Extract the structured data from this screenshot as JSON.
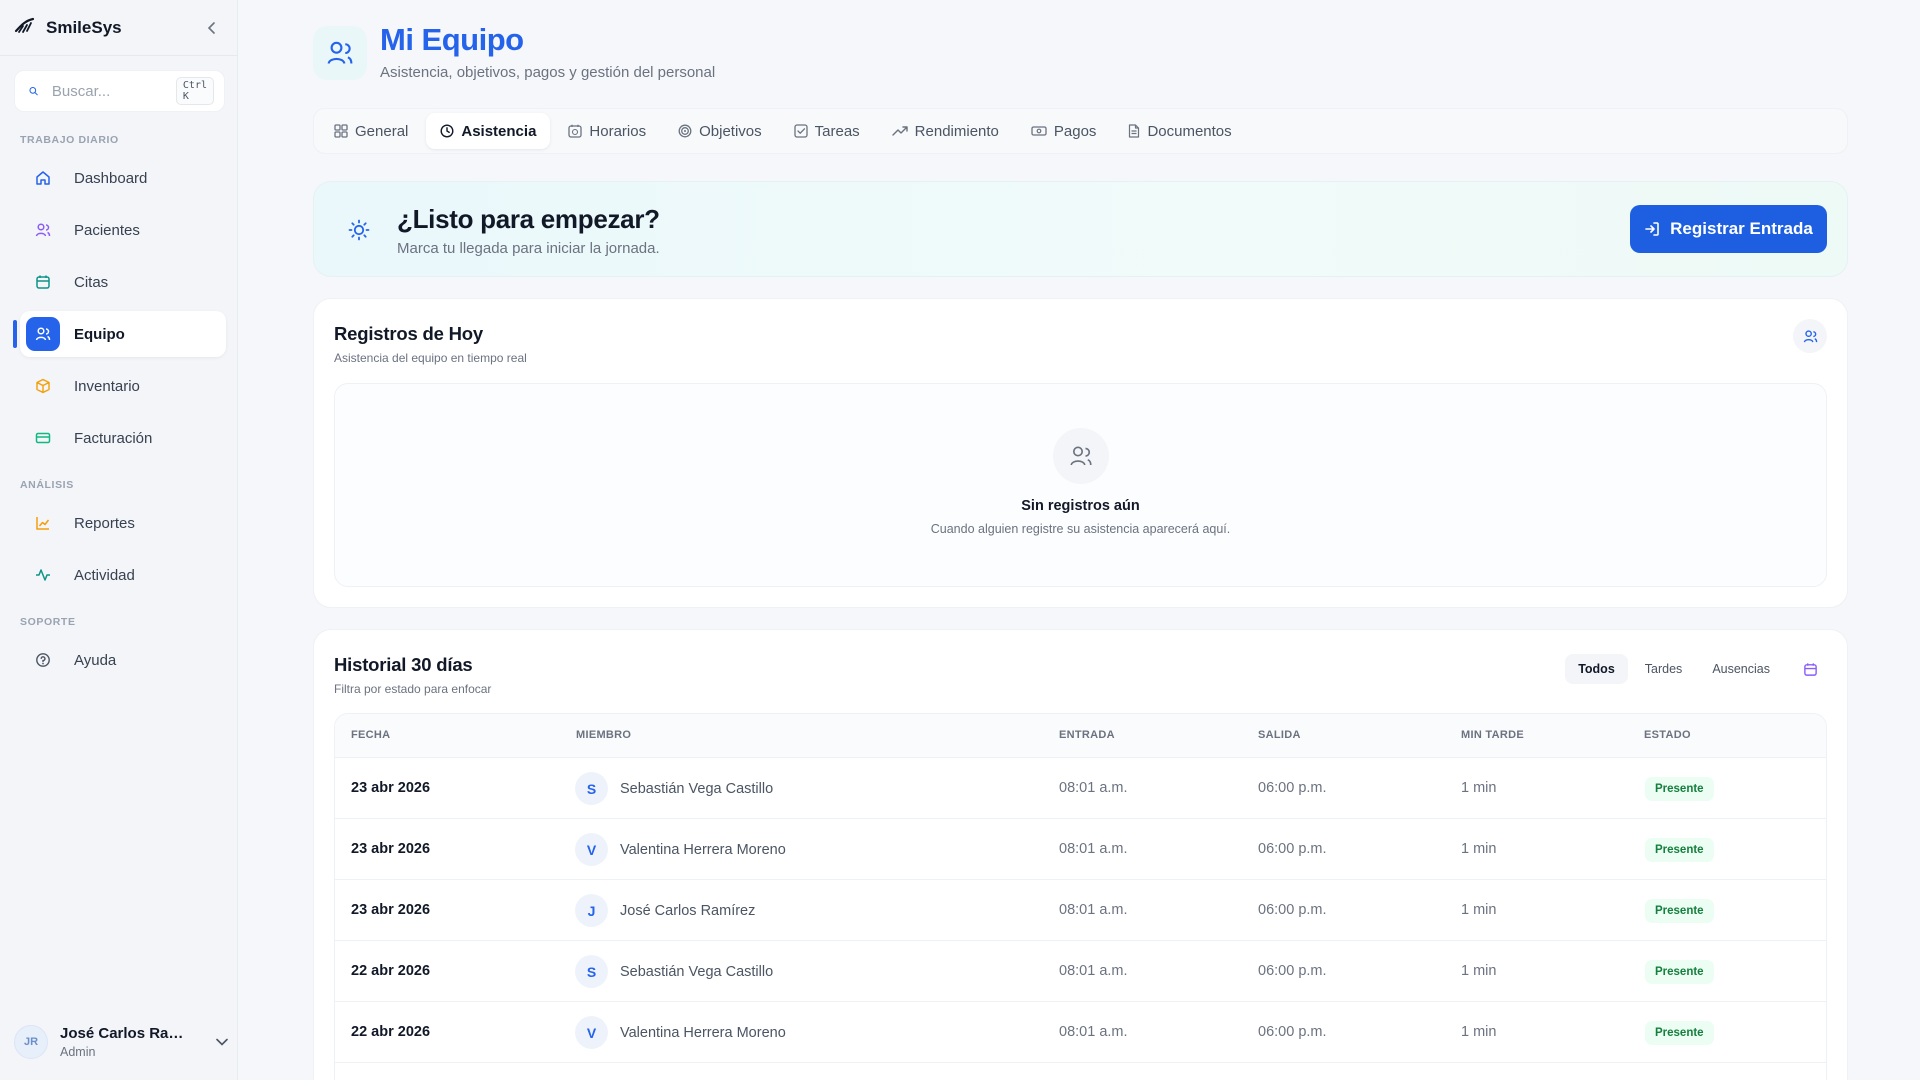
{
  "sidebar": {
    "brand": "SmileSys",
    "search": {
      "placeholder": "Buscar...",
      "shortcut": "Ctrl K"
    },
    "sections": [
      {
        "label": "TRABAJO DIARIO",
        "items": [
          {
            "label": "Dashboard",
            "icon": "home-icon"
          },
          {
            "label": "Pacientes",
            "icon": "users-icon"
          },
          {
            "label": "Citas",
            "icon": "calendar-icon"
          },
          {
            "label": "Equipo",
            "icon": "team-icon",
            "active": true
          },
          {
            "label": "Inventario",
            "icon": "box-icon"
          },
          {
            "label": "Facturación",
            "icon": "card-icon"
          }
        ]
      },
      {
        "label": "ANÁLISIS",
        "items": [
          {
            "label": "Reportes",
            "icon": "chart-icon"
          },
          {
            "label": "Actividad",
            "icon": "activity-icon"
          }
        ]
      },
      {
        "label": "SOPORTE",
        "items": [
          {
            "label": "Ayuda",
            "icon": "help-icon"
          }
        ]
      }
    ],
    "user": {
      "initials": "JR",
      "name": "José Carlos Ramír...",
      "role": "Admin"
    }
  },
  "header": {
    "title": "Mi Equipo",
    "subtitle": "Asistencia, objetivos, pagos y gestión del personal"
  },
  "tabs": [
    {
      "label": "General",
      "icon": "grid-icon"
    },
    {
      "label": "Asistencia",
      "icon": "clock-icon",
      "active": true
    },
    {
      "label": "Horarios",
      "icon": "calendar-clock-icon"
    },
    {
      "label": "Objetivos",
      "icon": "target-icon"
    },
    {
      "label": "Tareas",
      "icon": "checkbox-icon"
    },
    {
      "label": "Rendimiento",
      "icon": "trending-icon"
    },
    {
      "label": "Pagos",
      "icon": "money-icon"
    },
    {
      "label": "Documentos",
      "icon": "document-icon"
    }
  ],
  "cta": {
    "title": "¿Listo para empezar?",
    "subtitle": "Marca tu llegada para iniciar la jornada.",
    "button": "Registrar Entrada"
  },
  "today": {
    "title": "Registros de Hoy",
    "subtitle": "Asistencia del equipo en tiempo real",
    "empty_title": "Sin registros aún",
    "empty_subtitle": "Cuando alguien registre su asistencia aparecerá aquí."
  },
  "history": {
    "title": "Historial 30 días",
    "subtitle": "Filtra por estado para enfocar",
    "filters": [
      "Todos",
      "Tardes",
      "Ausencias"
    ],
    "active_filter": "Todos",
    "columns": [
      "FECHA",
      "MIEMBRO",
      "ENTRADA",
      "SALIDA",
      "MIN TARDE",
      "ESTADO"
    ],
    "rows": [
      {
        "date": "23 abr 2026",
        "initial": "S",
        "member": "Sebastián Vega Castillo",
        "in": "08:01 a.m.",
        "out": "06:00 p.m.",
        "late": "1 min",
        "status": "Presente"
      },
      {
        "date": "23 abr 2026",
        "initial": "V",
        "member": "Valentina Herrera Moreno",
        "in": "08:01 a.m.",
        "out": "06:00 p.m.",
        "late": "1 min",
        "status": "Presente"
      },
      {
        "date": "23 abr 2026",
        "initial": "J",
        "member": "José Carlos Ramírez",
        "in": "08:01 a.m.",
        "out": "06:00 p.m.",
        "late": "1 min",
        "status": "Presente"
      },
      {
        "date": "22 abr 2026",
        "initial": "S",
        "member": "Sebastián Vega Castillo",
        "in": "08:01 a.m.",
        "out": "06:00 p.m.",
        "late": "1 min",
        "status": "Presente"
      },
      {
        "date": "22 abr 2026",
        "initial": "V",
        "member": "Valentina Herrera Moreno",
        "in": "08:01 a.m.",
        "out": "06:00 p.m.",
        "late": "1 min",
        "status": "Presente"
      }
    ]
  },
  "colors": {
    "accent": "#2563eb",
    "success": "#15803d"
  }
}
